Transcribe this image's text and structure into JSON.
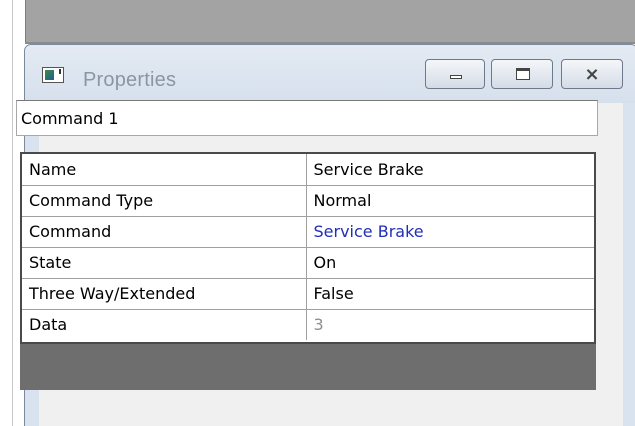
{
  "window": {
    "title": "Properties",
    "minimize_glyph": "",
    "maximize_glyph": "",
    "close_glyph": "⨯"
  },
  "name_field": {
    "value": "Command 1"
  },
  "properties": [
    {
      "key": "Name",
      "value": "Service Brake",
      "style": "normal"
    },
    {
      "key": "Command Type",
      "value": "Normal",
      "style": "normal"
    },
    {
      "key": "Command",
      "value": "Service Brake",
      "style": "link"
    },
    {
      "key": "State",
      "value": "On",
      "style": "normal"
    },
    {
      "key": "Three Way/Extended",
      "value": "False",
      "style": "normal"
    },
    {
      "key": "Data",
      "value": "3",
      "style": "readonly"
    }
  ],
  "colors": {
    "link": "#1f2fb8",
    "readonly": "#8f8f8f",
    "title_text": "#8a96a4"
  }
}
